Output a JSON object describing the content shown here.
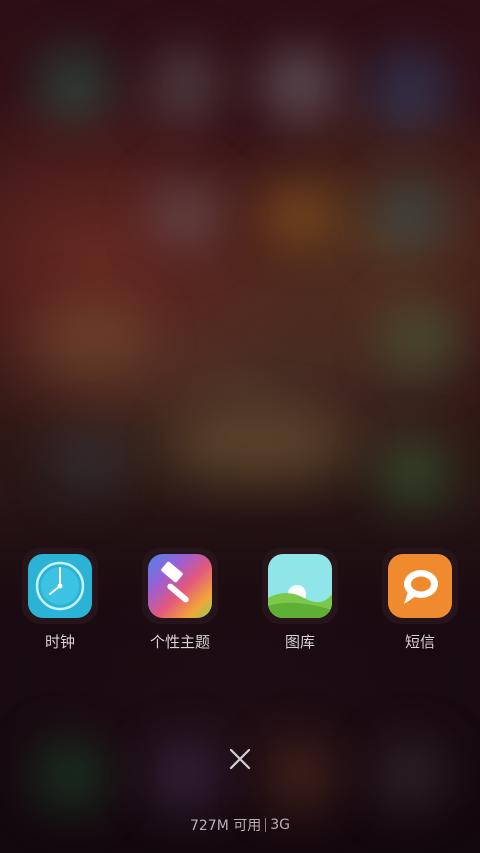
{
  "recent_apps": [
    {
      "name": "时钟",
      "icon": "clock-icon"
    },
    {
      "name": "个性主题",
      "icon": "themes-icon"
    },
    {
      "name": "图库",
      "icon": "gallery-icon"
    },
    {
      "name": "短信",
      "icon": "messages-icon"
    }
  ],
  "close_button": {
    "icon": "close-icon"
  },
  "status": {
    "memory_available": "727M 可用",
    "network": "3G"
  },
  "colors": {
    "clock_bg": "#2bb3d6",
    "messages_bg": "#f08a2e",
    "gallery_sky": "#8fe5e8",
    "gallery_hill": "#7cc94a",
    "label_text": "#d8d2d4"
  }
}
